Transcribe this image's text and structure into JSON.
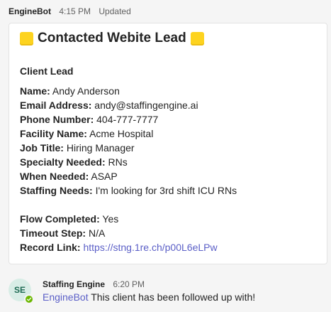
{
  "message": {
    "sender": "EngineBot",
    "time": "4:15 PM",
    "status": "Updated"
  },
  "card": {
    "title": "Contacted Webite Lead",
    "title_emoji": "yellow-square",
    "section": "Client Lead",
    "fields": [
      {
        "key": "Name:",
        "value": "Andy Anderson"
      },
      {
        "key": "Email Address:",
        "value": "andy@staffingengine.ai"
      },
      {
        "key": "Phone Number:",
        "value": "404-777-7777"
      },
      {
        "key": "Facility Name:",
        "value": "Acme Hospital"
      },
      {
        "key": "Job Title:",
        "value": "Hiring Manager"
      },
      {
        "key": "Specialty Needed:",
        "value": "RNs"
      },
      {
        "key": "When Needed:",
        "value": "ASAP"
      },
      {
        "key": "Staffing Needs:",
        "value": "I'm looking for 3rd shift ICU RNs"
      }
    ],
    "flow_fields": [
      {
        "key": "Flow Completed:",
        "value": "Yes"
      },
      {
        "key": "Timeout Step:",
        "value": "N/A"
      },
      {
        "key": "Record Link:",
        "value": "https://stng.1re.ch/p00L6eLPw"
      }
    ]
  },
  "reply": {
    "avatar_initials": "SE",
    "sender": "Staffing Engine",
    "time": "6:20 PM",
    "mention": "EngineBot",
    "text": "This client has been followed up with!"
  },
  "colors": {
    "link": "#5b5fc7",
    "emoji_yellow": "#fdd31f",
    "presence_green": "#6bb700"
  }
}
